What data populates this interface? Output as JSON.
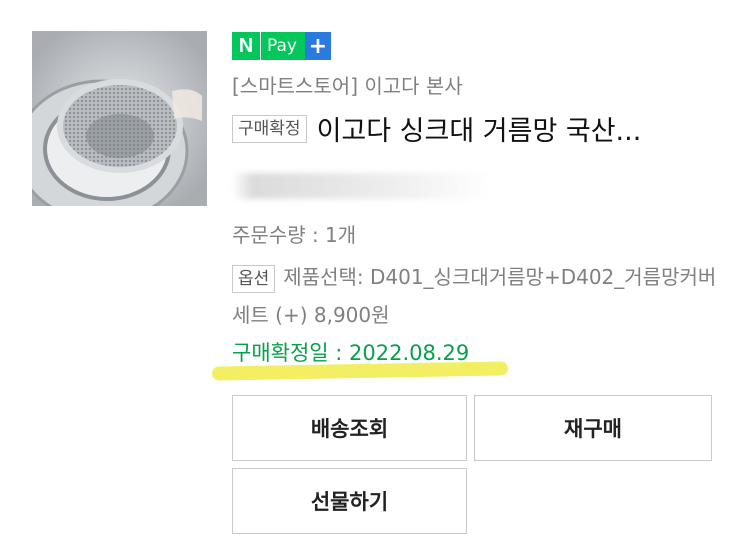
{
  "product": {
    "image_alt": "stainless sink strainer",
    "npay": {
      "n": "N",
      "pay": "Pay",
      "plus": "+"
    },
    "store": "[스마트스토어] 이고다 본사",
    "badge": "구매확정",
    "title": "이고다 싱크대 거름망 국산...",
    "quantity": "주문수량 : 1개",
    "option_badge": "옵션",
    "option_text": "제품선택: D401_싱크대거름망+D402_거름망커버 세트 (+) 8,900원",
    "confirm_date": "구매확정일 : 2022.08.29"
  },
  "buttons": {
    "track": "배송조회",
    "rebuy": "재구매",
    "gift": "선물하기"
  },
  "colors": {
    "npay_green": "#03c75a",
    "npay_blue": "#2b7ae0",
    "confirm_green": "#08a04b",
    "highlight_yellow": "#f2ee5c"
  }
}
